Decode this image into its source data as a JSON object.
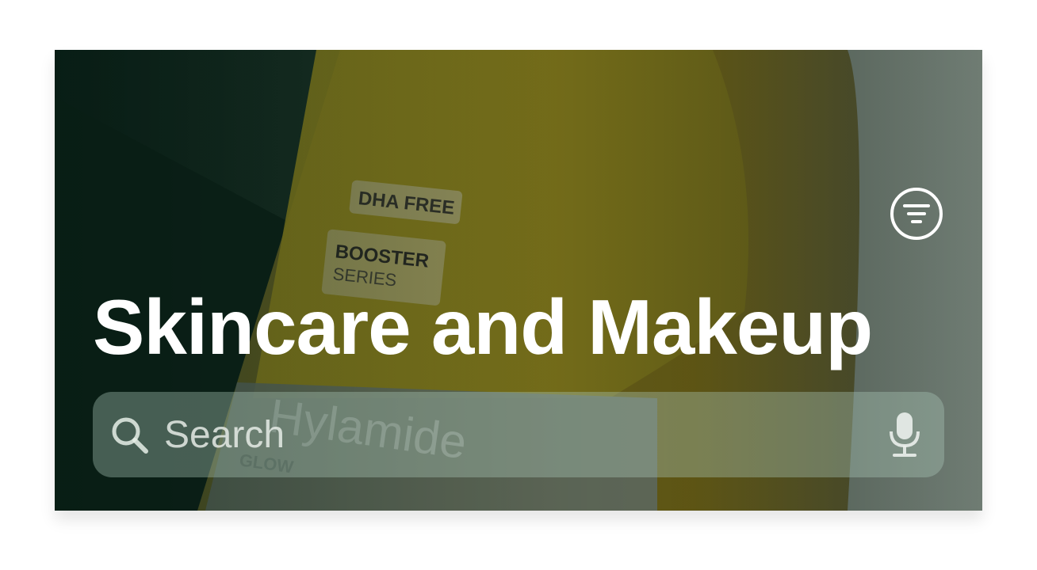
{
  "header": {
    "title": "Skincare and Makeup",
    "filter_icon": "filter-lines-icon"
  },
  "search": {
    "placeholder": "Search",
    "value": "",
    "search_icon": "magnifying-glass-icon",
    "mic_icon": "microphone-icon"
  },
  "background": {
    "description_icon": "product-photo",
    "label_badge_1": "DHA FREE",
    "label_badge_2_line1": "BOOSTER",
    "label_badge_2_line2": "SERIES",
    "label_product": "Hylamide",
    "label_sub": "GLOW",
    "colors": {
      "bottle_yellow": "#8a7f1c",
      "dark_green": "#13291f",
      "wall": "#5d6b60"
    }
  }
}
